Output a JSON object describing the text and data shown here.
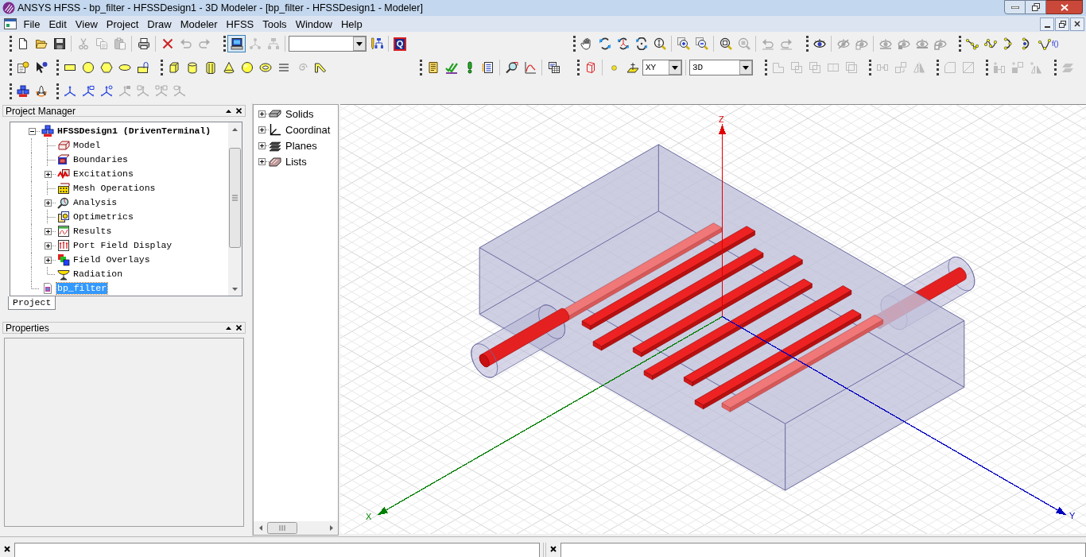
{
  "window": {
    "title": "ANSYS HFSS - bp_filter - HFSSDesign1 - 3D Modeler - [bp_filter - HFSSDesign1 - Modeler]"
  },
  "menu_bar": {
    "items": [
      "File",
      "Edit",
      "View",
      "Project",
      "Draw",
      "Modeler",
      "HFSS",
      "Tools",
      "Window",
      "Help"
    ]
  },
  "toolbar_rows": [
    {
      "toolbars": [
        {
          "groups": [
            [
              {
                "kind": "new",
                "disabled": false
              },
              {
                "kind": "open",
                "disabled": false
              },
              {
                "kind": "save",
                "disabled": false
              }
            ],
            [
              {
                "kind": "cut",
                "disabled": true
              },
              {
                "kind": "copy",
                "disabled": true
              },
              {
                "kind": "paste",
                "disabled": true
              }
            ],
            [
              {
                "kind": "print",
                "disabled": false
              }
            ],
            [
              {
                "kind": "delete",
                "disabled": false
              },
              {
                "kind": "undo",
                "disabled": true
              },
              {
                "kind": "redo",
                "disabled": true
              }
            ]
          ]
        },
        {
          "groups": [
            [
              {
                "kind": "select",
                "disabled": false,
                "selected": true
              },
              {
                "kind": "branch",
                "disabled": true,
                "selected": false
              },
              {
                "kind": "fork",
                "disabled": true,
                "selected": false
              }
            ],
            [
              {
                "kind": "dropdown",
                "disabled": false
              },
              {
                "kind": "hierarchy",
                "disabled": false
              }
            ],
            [
              {
                "kind": "report",
                "label": "Q",
                "disabled": false
              }
            ]
          ]
        },
        {
          "groups": [
            [
              {
                "kind": "pan",
                "disabled": false
              },
              {
                "kind": "rotate",
                "disabled": false
              },
              {
                "kind": "orbit",
                "disabled": false
              },
              {
                "kind": "spin",
                "disabled": false
              },
              {
                "kind": "zoomdrag",
                "disabled": false
              }
            ],
            [
              {
                "kind": "zoomin",
                "disabled": false
              },
              {
                "kind": "zoomout",
                "disabled": false
              }
            ],
            [
              {
                "kind": "fitall",
                "disabled": false
              },
              {
                "kind": "fitselected",
                "disabled": true
              }
            ],
            [
              {
                "kind": "undoview",
                "disabled": true
              },
              {
                "kind": "redoview",
                "disabled": true
              }
            ]
          ]
        },
        {
          "groups": [
            [
              {
                "kind": "show",
                "disabled": false
              }
            ],
            [
              {
                "kind": "hide",
                "disabled": true
              },
              {
                "kind": "isolate",
                "disabled": true
              }
            ],
            [
              {
                "kind": "showall",
                "disabled": true
              },
              {
                "kind": "hideall",
                "disabled": true
              },
              {
                "kind": "showonly",
                "disabled": true
              },
              {
                "kind": "hideonly",
                "disabled": true
              }
            ]
          ]
        },
        {
          "groups": [
            [
              {
                "kind": "polyline",
                "disabled": false
              },
              {
                "kind": "spline",
                "disabled": false
              },
              {
                "kind": "arc",
                "disabled": false
              },
              {
                "kind": "centerarc",
                "disabled": false
              },
              {
                "kind": "equation",
                "label": "f()",
                "disabled": false
              }
            ]
          ]
        }
      ]
    },
    {
      "toolbars": [
        {
          "groups": [
            [
              {
                "kind": "contexthelp",
                "disabled": false
              },
              {
                "kind": "whatsthis",
                "disabled": false
              }
            ]
          ]
        },
        {
          "groups": [
            [
              {
                "kind": "rectangle",
                "disabled": false
              },
              {
                "kind": "circle",
                "disabled": false
              },
              {
                "kind": "polygon",
                "disabled": false
              },
              {
                "kind": "ellipse",
                "disabled": false
              },
              {
                "kind": "region",
                "disabled": false
              }
            ]
          ]
        },
        {
          "groups": [
            [
              {
                "kind": "box",
                "disabled": false
              },
              {
                "kind": "cylinder",
                "disabled": false
              },
              {
                "kind": "polyhedron",
                "disabled": false
              },
              {
                "kind": "cone",
                "disabled": false
              },
              {
                "kind": "sphere",
                "disabled": false
              },
              {
                "kind": "torus",
                "disabled": false
              },
              {
                "kind": "helix",
                "disabled": false
              },
              {
                "kind": "spiral",
                "disabled": true
              },
              {
                "kind": "bondwire",
                "disabled": false
              }
            ]
          ]
        },
        {
          "groups": [
            [
              {
                "kind": "script",
                "disabled": false
              },
              {
                "kind": "validate",
                "disabled": false
              },
              {
                "kind": "analyze",
                "disabled": false
              },
              {
                "kind": "notes",
                "disabled": false
              }
            ],
            [
              {
                "kind": "fields",
                "disabled": false
              },
              {
                "kind": "plot",
                "disabled": false
              }
            ],
            [
              {
                "kind": "table",
                "disabled": false
              }
            ]
          ]
        },
        {
          "groups": [
            [
              {
                "kind": "object",
                "disabled": false
              }
            ],
            [
              {
                "kind": "point",
                "disabled": false
              },
              {
                "kind": "plane",
                "disabled": false
              },
              {
                "kind": "planecombo",
                "value": "XY",
                "disabled": false
              }
            ],
            [
              {
                "kind": "modecombo",
                "value": "3D",
                "disabled": false
              }
            ]
          ]
        },
        {
          "groups": [
            [
              {
                "kind": "unite",
                "disabled": true
              },
              {
                "kind": "subtract",
                "disabled": true
              },
              {
                "kind": "intersect",
                "disabled": true
              },
              {
                "kind": "split",
                "disabled": true
              },
              {
                "kind": "imprint",
                "disabled": true
              }
            ]
          ]
        },
        {
          "groups": [
            [
              {
                "kind": "move",
                "disabled": true
              },
              {
                "kind": "duplicate",
                "disabled": true
              },
              {
                "kind": "mirror",
                "disabled": true
              }
            ]
          ]
        },
        {
          "groups": [
            [
              {
                "kind": "sheet",
                "disabled": true
              },
              {
                "kind": "slice",
                "disabled": true
              }
            ]
          ]
        },
        {
          "groups": [
            [
              {
                "kind": "moveadd",
                "disabled": true
              },
              {
                "kind": "dupadd",
                "disabled": true
              },
              {
                "kind": "mirroradd",
                "disabled": true
              }
            ]
          ]
        },
        {
          "groups": [
            [
              {
                "kind": "surface",
                "disabled": true
              }
            ]
          ]
        }
      ]
    },
    {
      "toolbars": [
        {
          "groups": [
            [
              {
                "kind": "design",
                "disabled": false
              },
              {
                "kind": "iedesign",
                "disabled": false
              }
            ]
          ]
        },
        {
          "groups": [
            [
              {
                "kind": "relcs",
                "disabled": false
              },
              {
                "kind": "facecs",
                "disabled": false
              },
              {
                "kind": "objcs",
                "disabled": false
              },
              {
                "kind": "offsetcs",
                "disabled": true
              },
              {
                "kind": "rotatedcs",
                "disabled": true
              },
              {
                "kind": "bothcs",
                "disabled": true
              },
              {
                "kind": "setcs",
                "disabled": true
              }
            ]
          ]
        }
      ]
    }
  ],
  "project_manager": {
    "title": "Project Manager",
    "tree": [
      {
        "label": "HFSSDesign1 (DrivenTerminal)",
        "kind": "design",
        "expandable": true,
        "expanded": true,
        "active": true,
        "selected": false,
        "children": [
          {
            "label": "Model",
            "kind": "model",
            "expandable": false,
            "selected": false
          },
          {
            "label": "Boundaries",
            "kind": "boundaries",
            "expandable": false,
            "selected": false
          },
          {
            "label": "Excitations",
            "kind": "excitations",
            "expandable": true,
            "expanded": false,
            "selected": false
          },
          {
            "label": "Mesh Operations",
            "kind": "mesh",
            "expandable": false,
            "selected": false
          },
          {
            "label": "Analysis",
            "kind": "analysis",
            "expandable": true,
            "expanded": false,
            "selected": false
          },
          {
            "label": "Optimetrics",
            "kind": "optimetrics",
            "expandable": false,
            "selected": false
          },
          {
            "label": "Results",
            "kind": "results",
            "expandable": true,
            "expanded": false,
            "selected": false
          },
          {
            "label": "Port Field Display",
            "kind": "portfield",
            "expandable": true,
            "expanded": false,
            "selected": false
          },
          {
            "label": "Field Overlays",
            "kind": "overlays",
            "expandable": true,
            "expanded": false,
            "selected": false
          },
          {
            "label": "Radiation",
            "kind": "radiation",
            "expandable": false,
            "selected": false
          }
        ]
      },
      {
        "label": "bp_filter",
        "kind": "project",
        "expandable": false,
        "active": false,
        "selected": true
      }
    ],
    "tabs": [
      {
        "label": "Project",
        "selected": true
      }
    ]
  },
  "properties": {
    "title": "Properties"
  },
  "model_tree": {
    "items": [
      {
        "label": "Solids",
        "kind": "solids",
        "expanded": false
      },
      {
        "label": "Coordinat",
        "kind": "coordinates",
        "expanded": false
      },
      {
        "label": "Planes",
        "kind": "planes",
        "expanded": false
      },
      {
        "label": "Lists",
        "kind": "lists",
        "expanded": false
      }
    ]
  },
  "viewport": {
    "axes": [
      {
        "label": "Z",
        "color": "#e00000"
      },
      {
        "label": "X",
        "color": "#008000"
      },
      {
        "label": "Y",
        "color": "#0000c0"
      }
    ]
  }
}
